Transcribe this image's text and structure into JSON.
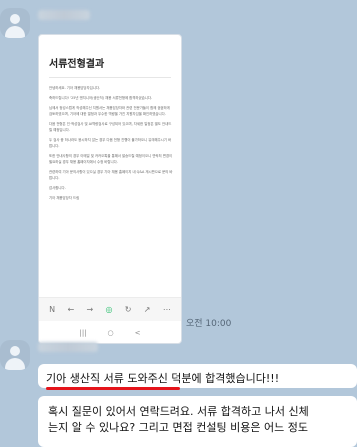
{
  "chat": {
    "message1": {
      "time": "오전 10:00",
      "screenshot": {
        "title": "서류전형결과",
        "body": [
          "안녕하세요.          기아 채용담당자입니다.",
          "축하드립니다! '25년 엔지니어(생산직) 채용 서류전형에 합격하셨습니다.",
          "          님께서 정성스럽게 작성해주신 지원서는 채용담당자와 관련 전문가들이 함께 꼼꼼하게 검토하였으며, 기아에 대한 열정과 우수한 역량을 가진 지원자임을 확인하였습니다.",
          "다음 전형은 인·적성검사 및 AI역량검사로 구성되어 있으며, 자세한 일정은 별도 안내드릴 예정입니다.",
          "두 검사 중 하나라도 응시하지 않는 경우 다음 전형 진행이 불가하오니 유의해주시기 바랍니다.",
          "또한 안내사항의 경우 이메일 및 카카오톡을 통해서 발송드릴 예정이오니 연락처 변경이 필요하실 경우 채용 홈페이지에서 수정 바랍니다.",
          "관련하여 기아 문의사항이 있으실 경우 기아 채용 홈페이지 내 Q&A 게시판으로 문의 바랍니다.",
          "감사합니다.",
          "기아 채용담당자 드림"
        ],
        "toolbar": [
          "N",
          "←",
          "→",
          "◎",
          "↻",
          "↗",
          "⋯"
        ],
        "nav": [
          "|||",
          "○",
          "<"
        ]
      }
    },
    "message2": {
      "line1": "기아 생산직 서류 도와주신 덕분에 합격했습니다!!!",
      "line2": "혹시 질문이 있어서 연락드려요. 서류 합격하고 나서 신체",
      "line3": "는지 알 수 있나요? 그리고 면접 컨설팅 비용은 어느 정도"
    }
  },
  "colors": {
    "background": "#b2c7da",
    "bubble": "#ffffff",
    "underline": "#e5141b"
  }
}
